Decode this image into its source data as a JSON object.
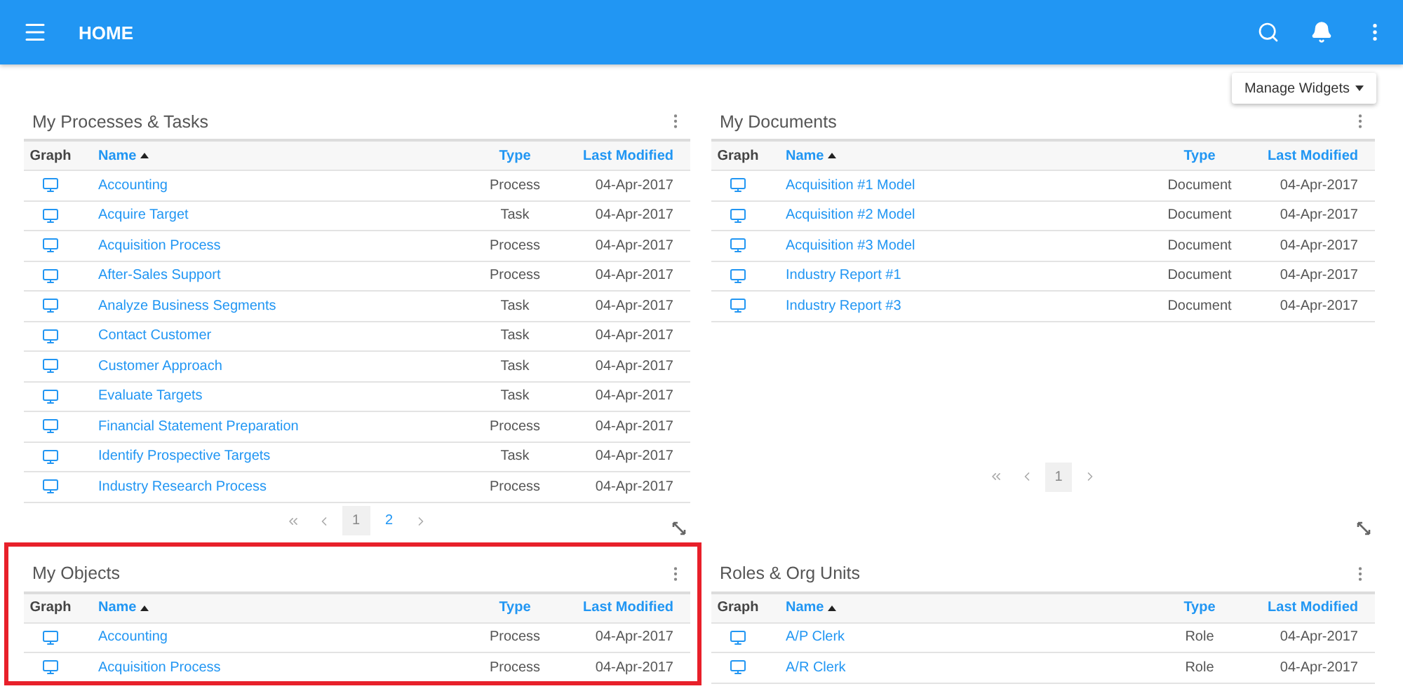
{
  "app_bar": {
    "title": "HOME"
  },
  "manage_widgets": {
    "label": "Manage Widgets"
  },
  "widgets": [
    {
      "title": "My Processes & Tasks",
      "highlighted": false,
      "columns": [
        {
          "label": "Graph",
          "kind": "graph",
          "sorted": false
        },
        {
          "label": "Name",
          "kind": "name",
          "sorted": true
        },
        {
          "label": "Type",
          "kind": "type",
          "sorted": false
        },
        {
          "label": "Last Modified",
          "kind": "date",
          "sorted": false
        }
      ],
      "rows": [
        {
          "name": "Accounting",
          "type": "Process",
          "modified": "04-Apr-2017"
        },
        {
          "name": "Acquire Target",
          "type": "Task",
          "modified": "04-Apr-2017"
        },
        {
          "name": "Acquisition Process",
          "type": "Process",
          "modified": "04-Apr-2017"
        },
        {
          "name": "After-Sales Support",
          "type": "Process",
          "modified": "04-Apr-2017"
        },
        {
          "name": "Analyze Business Segments",
          "type": "Task",
          "modified": "04-Apr-2017"
        },
        {
          "name": "Contact Customer",
          "type": "Task",
          "modified": "04-Apr-2017"
        },
        {
          "name": "Customer Approach",
          "type": "Task",
          "modified": "04-Apr-2017"
        },
        {
          "name": "Evaluate Targets",
          "type": "Task",
          "modified": "04-Apr-2017"
        },
        {
          "name": "Financial Statement Preparation",
          "type": "Process",
          "modified": "04-Apr-2017"
        },
        {
          "name": "Identify Prospective Targets",
          "type": "Task",
          "modified": "04-Apr-2017"
        },
        {
          "name": "Industry Research Process",
          "type": "Process",
          "modified": "04-Apr-2017"
        }
      ],
      "pages": [
        {
          "label": "1",
          "selected": true
        },
        {
          "label": "2",
          "selected": false
        }
      ]
    },
    {
      "title": "My Documents",
      "highlighted": false,
      "columns": [
        {
          "label": "Graph",
          "kind": "graph",
          "sorted": false
        },
        {
          "label": "Name",
          "kind": "name",
          "sorted": true
        },
        {
          "label": "Type",
          "kind": "type",
          "sorted": false
        },
        {
          "label": "Last Modified",
          "kind": "date",
          "sorted": false
        }
      ],
      "rows": [
        {
          "name": "Acquisition #1 Model",
          "type": "Document",
          "modified": "04-Apr-2017"
        },
        {
          "name": "Acquisition #2 Model",
          "type": "Document",
          "modified": "04-Apr-2017"
        },
        {
          "name": "Acquisition #3 Model",
          "type": "Document",
          "modified": "04-Apr-2017"
        },
        {
          "name": "Industry Report #1",
          "type": "Document",
          "modified": "04-Apr-2017"
        },
        {
          "name": "Industry Report #3",
          "type": "Document",
          "modified": "04-Apr-2017"
        }
      ],
      "pages": [
        {
          "label": "1",
          "selected": true
        }
      ]
    },
    {
      "title": "My Objects",
      "highlighted": true,
      "columns": [
        {
          "label": "Graph",
          "kind": "graph",
          "sorted": false
        },
        {
          "label": "Name",
          "kind": "name",
          "sorted": true
        },
        {
          "label": "Type",
          "kind": "type",
          "sorted": false
        },
        {
          "label": "Last Modified",
          "kind": "date",
          "sorted": false
        }
      ],
      "rows": [
        {
          "name": "Accounting",
          "type": "Process",
          "modified": "04-Apr-2017"
        },
        {
          "name": "Acquisition Process",
          "type": "Process",
          "modified": "04-Apr-2017"
        }
      ]
    },
    {
      "title": "Roles & Org Units",
      "highlighted": false,
      "columns": [
        {
          "label": "Graph",
          "kind": "graph",
          "sorted": false
        },
        {
          "label": "Name",
          "kind": "name",
          "sorted": true
        },
        {
          "label": "Type",
          "kind": "type",
          "sorted": false
        },
        {
          "label": "Last Modified",
          "kind": "date",
          "sorted": false
        }
      ],
      "rows": [
        {
          "name": "A/P Clerk",
          "type": "Role",
          "modified": "04-Apr-2017"
        },
        {
          "name": "A/R Clerk",
          "type": "Role",
          "modified": "04-Apr-2017"
        }
      ]
    }
  ]
}
